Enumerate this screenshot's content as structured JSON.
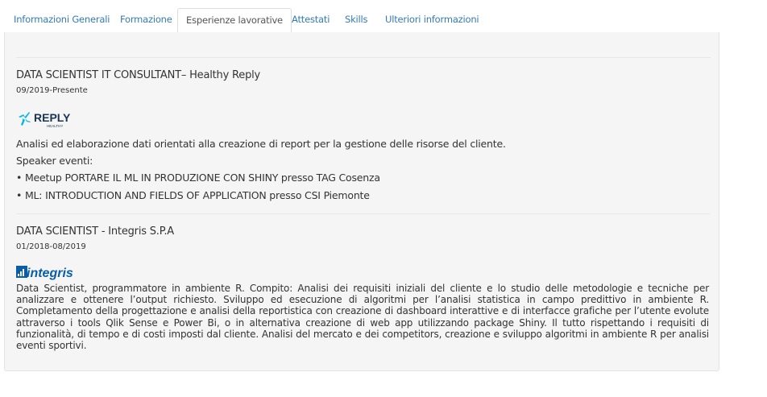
{
  "tabs": [
    {
      "label": "Informazioni Generali"
    },
    {
      "label": "Formazione"
    },
    {
      "label": "Esperienze lavorative"
    },
    {
      "label": "Attestati"
    },
    {
      "label": "Skills"
    },
    {
      "label": "Ulteriori informazioni"
    }
  ],
  "active_tab": "Esperienze lavorative",
  "experiences": [
    {
      "title": "DATA SCIENTIST IT CONSULTANT– Healthy Reply",
      "dates": "09/2019-Presente",
      "logo": {
        "icon": "reply-logo",
        "text": "REPLY",
        "subtext": "HEALTHY",
        "color": "#1a3553",
        "accent": "#00b7e8"
      },
      "lines": [
        "Analisi ed elaborazione dati orientati alla creazione di report per la gestione delle risorse del cliente.",
        "Speaker eventi:",
        "• Meetup PORTARE IL ML IN PRODUZIONE CON SHINY presso TAG Cosenza",
        "• ML: INTRODUCTION AND FIELDS OF APPLICATION presso CSI Piemonte"
      ]
    },
    {
      "title": "DATA SCIENTIST - Integris S.P.A",
      "dates": "01/2018-08/2019",
      "logo": {
        "icon": "integris-logo",
        "text": "integris",
        "color": "#0a5ea8"
      },
      "description": "Data Scientist, programmatore in ambiente R. Compito: Analisi dei requisiti iniziali del cliente e lo studio delle metodologie e tecniche per analizzare e ottenere l’output richiesto. Sviluppo ed esecuzione di algoritmi per l’analisi statistica in campo predittivo in ambiente R. Completamento della progettazione e analisi della reportistica con creazione di dashboard interattive e di interfacce grafiche per l’utente evolute attraverso i tools Qlik Sense e Power Bi, o in alternativa creazione di web app utilizzando package Shiny. Il tutto rispettando i requisiti di funzionalità, di tempo e di costi imposti dal cliente. Analisi del mercato e dei competitors, creazione e sviluppo algoritmi in ambiente R per analisi eventi sportivi."
    }
  ]
}
